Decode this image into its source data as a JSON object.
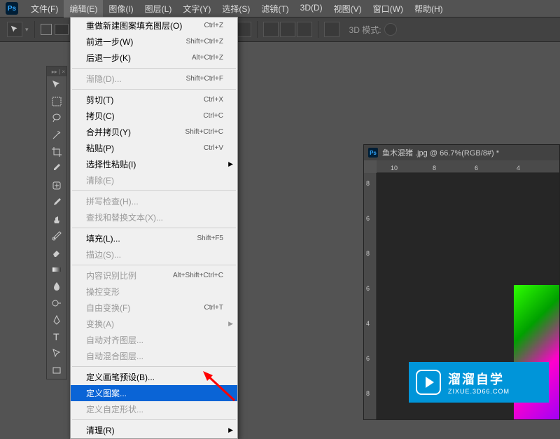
{
  "app": {
    "logo": "Ps"
  },
  "menubar": [
    {
      "label": "文件(F)",
      "active": false
    },
    {
      "label": "编辑(E)",
      "active": true
    },
    {
      "label": "图像(I)",
      "active": false
    },
    {
      "label": "图层(L)",
      "active": false
    },
    {
      "label": "文字(Y)",
      "active": false
    },
    {
      "label": "选择(S)",
      "active": false
    },
    {
      "label": "滤镜(T)",
      "active": false
    },
    {
      "label": "3D(D)",
      "active": false
    },
    {
      "label": "视图(V)",
      "active": false
    },
    {
      "label": "窗口(W)",
      "active": false
    },
    {
      "label": "帮助(H)",
      "active": false
    }
  ],
  "optionsbar": {
    "mode3d": "3D 模式:"
  },
  "dropdown": [
    {
      "label": "重做新建图案填充图层(O)",
      "shortcut": "Ctrl+Z",
      "type": "item"
    },
    {
      "label": "前进一步(W)",
      "shortcut": "Shift+Ctrl+Z",
      "type": "item"
    },
    {
      "label": "后退一步(K)",
      "shortcut": "Alt+Ctrl+Z",
      "type": "item"
    },
    {
      "type": "sep"
    },
    {
      "label": "渐隐(D)...",
      "shortcut": "Shift+Ctrl+F",
      "type": "item",
      "disabled": true
    },
    {
      "type": "sep"
    },
    {
      "label": "剪切(T)",
      "shortcut": "Ctrl+X",
      "type": "item"
    },
    {
      "label": "拷贝(C)",
      "shortcut": "Ctrl+C",
      "type": "item"
    },
    {
      "label": "合并拷贝(Y)",
      "shortcut": "Shift+Ctrl+C",
      "type": "item"
    },
    {
      "label": "粘贴(P)",
      "shortcut": "Ctrl+V",
      "type": "item"
    },
    {
      "label": "选择性粘贴(I)",
      "shortcut": "",
      "type": "item",
      "submenu": true
    },
    {
      "label": "清除(E)",
      "shortcut": "",
      "type": "item",
      "disabled": true
    },
    {
      "type": "sep"
    },
    {
      "label": "拼写检查(H)...",
      "shortcut": "",
      "type": "item",
      "disabled": true
    },
    {
      "label": "查找和替换文本(X)...",
      "shortcut": "",
      "type": "item",
      "disabled": true
    },
    {
      "type": "sep"
    },
    {
      "label": "填充(L)...",
      "shortcut": "Shift+F5",
      "type": "item"
    },
    {
      "label": "描边(S)...",
      "shortcut": "",
      "type": "item",
      "disabled": true
    },
    {
      "type": "sep"
    },
    {
      "label": "内容识别比例",
      "shortcut": "Alt+Shift+Ctrl+C",
      "type": "item",
      "disabled": true
    },
    {
      "label": "操控变形",
      "shortcut": "",
      "type": "item",
      "disabled": true
    },
    {
      "label": "自由变换(F)",
      "shortcut": "Ctrl+T",
      "type": "item",
      "disabled": true
    },
    {
      "label": "变换(A)",
      "shortcut": "",
      "type": "item",
      "disabled": true,
      "submenu": true
    },
    {
      "label": "自动对齐图层...",
      "shortcut": "",
      "type": "item",
      "disabled": true
    },
    {
      "label": "自动混合图层...",
      "shortcut": "",
      "type": "item",
      "disabled": true
    },
    {
      "type": "sep"
    },
    {
      "label": "定义画笔预设(B)...",
      "shortcut": "",
      "type": "item"
    },
    {
      "label": "定义图案...",
      "shortcut": "",
      "type": "item",
      "highlight": true
    },
    {
      "label": "定义自定形状...",
      "shortcut": "",
      "type": "item",
      "disabled": true
    },
    {
      "type": "sep"
    },
    {
      "label": "清理(R)",
      "shortcut": "",
      "type": "item",
      "submenu": true
    }
  ],
  "document": {
    "title": "鱼木混猪 .jpg @ 66.7%(RGB/8#) *",
    "ruler_h": [
      "10",
      "8",
      "6",
      "4"
    ],
    "ruler_v": [
      "8",
      "6",
      "8",
      "6",
      "4",
      "6",
      "8"
    ]
  },
  "watermark": {
    "title": "溜溜自学",
    "sub": "ZIXUE.3D66.COM"
  }
}
